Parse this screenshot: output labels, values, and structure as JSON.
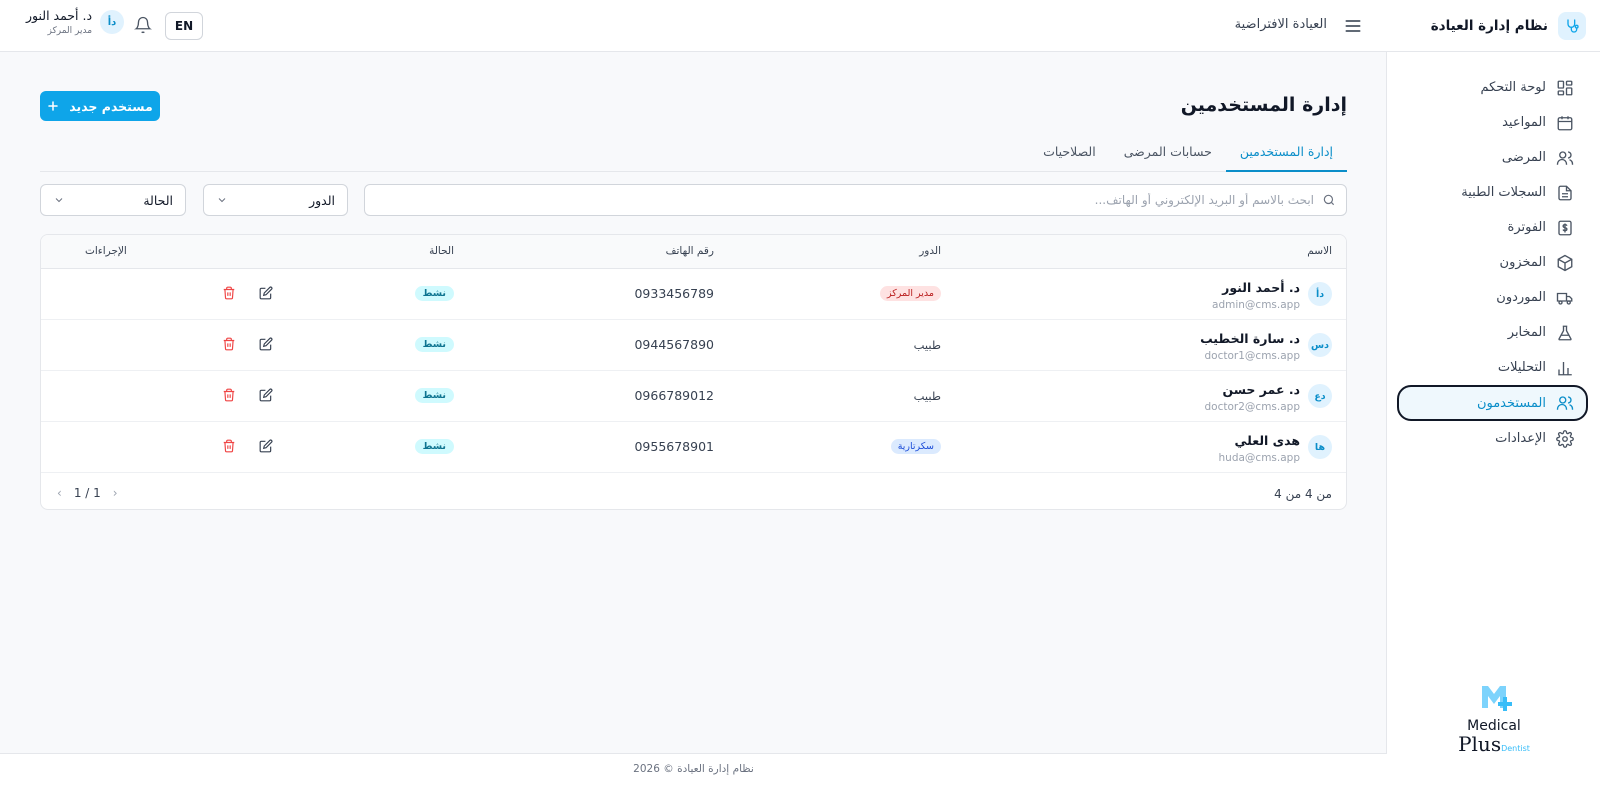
{
  "app": {
    "title": "نظام إدارة العيادة"
  },
  "sidebar": {
    "items": [
      {
        "label": "لوحة التحكم",
        "icon": "dashboard-icon"
      },
      {
        "label": "المواعيد",
        "icon": "calendar-icon"
      },
      {
        "label": "المرضى",
        "icon": "users-icon"
      },
      {
        "label": "السجلات الطبية",
        "icon": "file-icon"
      },
      {
        "label": "الفوترة",
        "icon": "dollar-icon"
      },
      {
        "label": "المخزون",
        "icon": "box-icon"
      },
      {
        "label": "الموردون",
        "icon": "truck-icon"
      },
      {
        "label": "المخابر",
        "icon": "flask-icon"
      },
      {
        "label": "التحليلات",
        "icon": "bar-chart-icon"
      },
      {
        "label": "المستخدمون",
        "icon": "users-icon",
        "active": true
      },
      {
        "label": "الإعدادات",
        "icon": "gear-icon"
      }
    ],
    "logo": {
      "word1": "Medical",
      "word2": "Plus",
      "word3": "Dentist"
    }
  },
  "header": {
    "clinic": "العيادة الافتراضية",
    "lang": "EN",
    "user_name": "د. أحمد النور",
    "user_role": "مدير المركز",
    "user_initials": "دأ"
  },
  "page": {
    "title": "إدارة المستخدمين",
    "new_button": "مستخدم جديد",
    "tabs": [
      "إدارة المستخدمين",
      "حسابات المرضى",
      "الصلاحيات"
    ],
    "search_placeholder": "ابحث بالاسم أو البريد الإلكتروني أو الهاتف...",
    "role_filter": "الدور",
    "status_filter": "الحالة"
  },
  "table": {
    "columns": {
      "name": "الاسم",
      "role": "الدور",
      "phone": "رقم الهاتف",
      "status": "الحالة",
      "actions": "الإجراءات"
    },
    "rows": [
      {
        "initials": "دأ",
        "name": "د. أحمد النور",
        "email": "admin@cms.app",
        "role": "مدير المركز",
        "role_style": "badge-red",
        "phone": "0933456789",
        "status": "نشط"
      },
      {
        "initials": "دس",
        "name": "د. سارة الخطيب",
        "email": "doctor1@cms.app",
        "role": "طبيب",
        "role_style": "text",
        "phone": "0944567890",
        "status": "نشط"
      },
      {
        "initials": "دع",
        "name": "د. عمر حسن",
        "email": "doctor2@cms.app",
        "role": "طبيب",
        "role_style": "text",
        "phone": "0966789012",
        "status": "نشط"
      },
      {
        "initials": "ها",
        "name": "هدى العلي",
        "email": "huda@cms.app",
        "role": "سكرتارية",
        "role_style": "badge-blue",
        "phone": "0955678901",
        "status": "نشط"
      }
    ],
    "count_text": "من 4 من 4",
    "pager": "1 / 1"
  },
  "footer": {
    "text": "نظام إدارة العيادة © 2026"
  },
  "colors": {
    "accent": "#0ea5e9",
    "active_text": "#0b8ec9",
    "danger": "#ef4444"
  }
}
